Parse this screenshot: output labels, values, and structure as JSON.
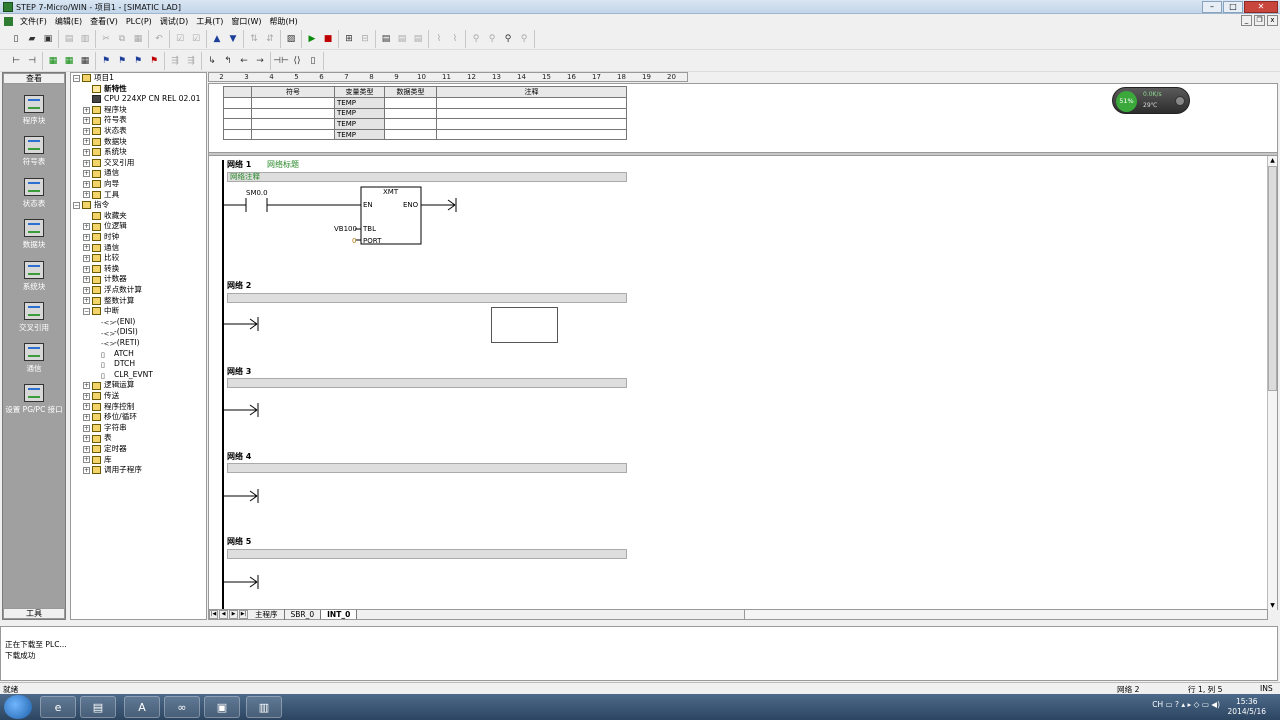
{
  "window": {
    "title": "STEP 7-Micro/WIN - 项目1 - [SIMATIC LAD]"
  },
  "menu": [
    "文件(F)",
    "编辑(E)",
    "查看(V)",
    "PLC(P)",
    "调试(D)",
    "工具(T)",
    "窗口(W)",
    "帮助(H)"
  ],
  "sidebar": {
    "header": "查看",
    "footer": "工具",
    "items": [
      "程序块",
      "符号表",
      "状态表",
      "数据块",
      "系统块",
      "交叉引用",
      "通信",
      "设置 PG/PC 接口"
    ]
  },
  "tree": {
    "project": "项目1",
    "items": [
      {
        "label": "新特性",
        "bold": true
      },
      {
        "label": "CPU 224XP CN REL 02.01"
      },
      {
        "label": "程序块"
      },
      {
        "label": "符号表"
      },
      {
        "label": "状态表"
      },
      {
        "label": "数据块"
      },
      {
        "label": "系统块"
      },
      {
        "label": "交叉引用"
      },
      {
        "label": "通信"
      },
      {
        "label": "向导"
      },
      {
        "label": "工具"
      }
    ],
    "instructions_root": "指令",
    "instructions": [
      "收藏夹",
      "位逻辑",
      "时钟",
      "通信",
      "比较",
      "转换",
      "计数器",
      "浮点数计算",
      "整数计算",
      "中断"
    ],
    "interrupt_children": [
      "-(ENI)",
      "-(DISI)",
      "-(RETI)",
      "ATCH",
      "DTCH",
      "CLR_EVNT"
    ],
    "more_instructions": [
      "逻辑运算",
      "传送",
      "程序控制",
      "移位/循环",
      "字符串",
      "表",
      "定时器",
      "库",
      "调用子程序"
    ]
  },
  "ruler": [
    "2",
    "3",
    "4",
    "5",
    "6",
    "7",
    "8",
    "9",
    "10",
    "11",
    "12",
    "13",
    "14",
    "15",
    "16",
    "17",
    "18",
    "19",
    "20"
  ],
  "var_table": {
    "headers": [
      "符号",
      "变量类型",
      "数据类型",
      "注释"
    ],
    "rows": [
      "TEMP",
      "TEMP",
      "TEMP",
      "TEMP"
    ]
  },
  "networks": [
    {
      "title": "网络 1",
      "label": "网络标题",
      "comment": "网络注释"
    },
    {
      "title": "网络 2",
      "comment": ""
    },
    {
      "title": "网络 3",
      "comment": ""
    },
    {
      "title": "网络 4",
      "comment": ""
    },
    {
      "title": "网络 5",
      "comment": ""
    }
  ],
  "network1": {
    "contact": "SM0.0",
    "box_name": "XMT",
    "en": "EN",
    "eno": "ENO",
    "tbl": "TBL",
    "port": "PORT",
    "tbl_operand": "VB100",
    "port_operand": "0"
  },
  "tabs": [
    "主程序",
    "SBR_0",
    "INT_0"
  ],
  "output": [
    "正在下载至 PLC...",
    "下载成功"
  ],
  "status": {
    "left": "就绪",
    "network": "网络 2",
    "position": "行 1, 列 5",
    "mode": "INS"
  },
  "gadget": {
    "cpu": "51%",
    "net": "0.0K/s",
    "temp": "29℃"
  },
  "taskbar": {
    "lang": "CH",
    "time": "15:36",
    "date": "2014/5/16"
  }
}
